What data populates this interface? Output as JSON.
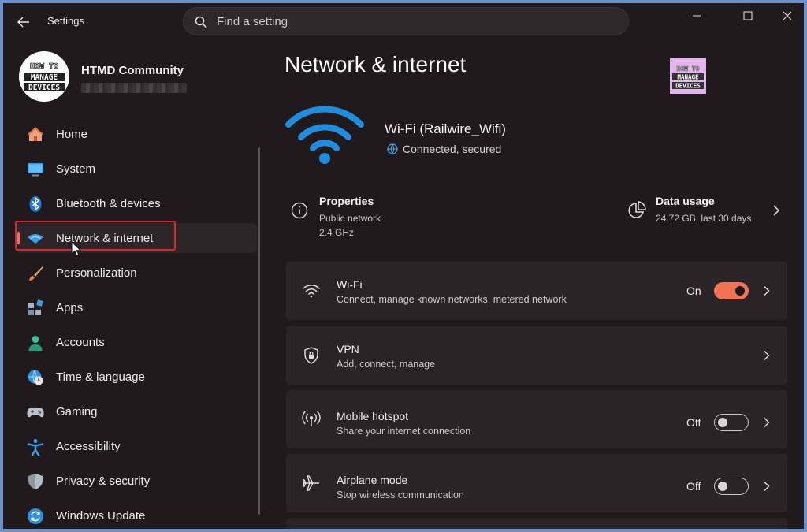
{
  "titlebar": {
    "app_title": "Settings",
    "search_placeholder": "Find a setting"
  },
  "profile": {
    "name": "HTMD Community",
    "logo_lines": [
      "HOW TO",
      "MANAGE",
      "DEVICES"
    ]
  },
  "sidebar": {
    "items": [
      {
        "label": "Home",
        "icon": "home-icon"
      },
      {
        "label": "System",
        "icon": "monitor-icon"
      },
      {
        "label": "Bluetooth & devices",
        "icon": "bluetooth-icon"
      },
      {
        "label": "Network & internet",
        "icon": "wifi-diamond-icon",
        "selected": true
      },
      {
        "label": "Personalization",
        "icon": "brush-icon"
      },
      {
        "label": "Apps",
        "icon": "apps-icon"
      },
      {
        "label": "Accounts",
        "icon": "person-icon"
      },
      {
        "label": "Time & language",
        "icon": "globe-clock-icon"
      },
      {
        "label": "Gaming",
        "icon": "gamepad-icon"
      },
      {
        "label": "Accessibility",
        "icon": "accessibility-icon"
      },
      {
        "label": "Privacy & security",
        "icon": "shield-icon"
      },
      {
        "label": "Windows Update",
        "icon": "update-icon"
      }
    ]
  },
  "main": {
    "title": "Network & internet",
    "connection": {
      "name": "Wi-Fi (Railwire_Wifi)",
      "status": "Connected, secured"
    },
    "properties": {
      "title": "Properties",
      "network_type": "Public network",
      "band": "2.4 GHz"
    },
    "data_usage": {
      "title": "Data usage",
      "value": "24.72 GB, last 30 days"
    },
    "cards": [
      {
        "title": "Wi-Fi",
        "subtitle": "Connect, manage known networks, metered network",
        "toggle_label": "On",
        "toggle_on": true
      },
      {
        "title": "VPN",
        "subtitle": "Add, connect, manage"
      },
      {
        "title": "Mobile hotspot",
        "subtitle": "Share your internet connection",
        "toggle_label": "Off",
        "toggle_on": false
      },
      {
        "title": "Airplane mode",
        "subtitle": "Stop wireless communication",
        "toggle_label": "Off",
        "toggle_on": false
      }
    ]
  },
  "colors": {
    "background": "#211a1c",
    "card": "#2b2426",
    "accent": "#f27252",
    "wifi_blue": "#1e8fe0",
    "highlight_border": "#e0242c"
  }
}
